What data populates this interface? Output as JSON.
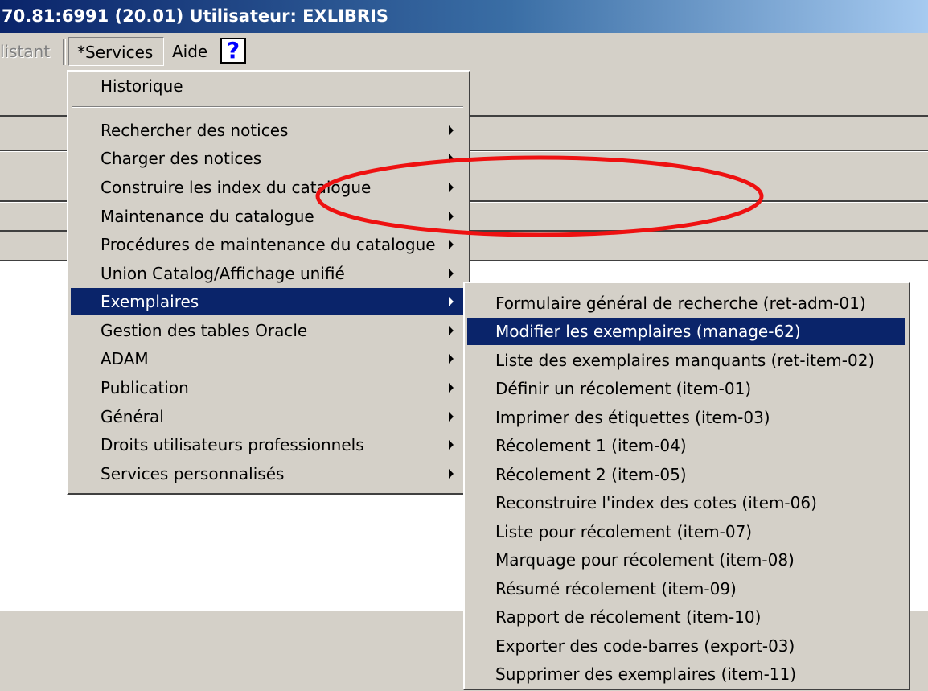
{
  "window": {
    "title": "70.81:6991 (20.01) Utilisateur: EXLIBRIS"
  },
  "menubar": {
    "assistant": "listant",
    "services": "*Services",
    "aide": "Aide",
    "help_glyph": "?"
  },
  "services_menu": {
    "items": [
      {
        "label": "Historique"
      },
      {
        "label": "Rechercher des notices"
      },
      {
        "label": "Charger des notices"
      },
      {
        "label": "Construire les index du catalogue"
      },
      {
        "label": "Maintenance du catalogue"
      },
      {
        "label": "Procédures de maintenance du catalogue"
      },
      {
        "label": "Union Catalog/Affichage unifié"
      },
      {
        "label": "Exemplaires"
      },
      {
        "label": "Gestion des tables Oracle"
      },
      {
        "label": "ADAM"
      },
      {
        "label": "Publication"
      },
      {
        "label": "Général"
      },
      {
        "label": "Droits utilisateurs professionnels"
      },
      {
        "label": "Services personnalisés"
      }
    ]
  },
  "exemplaires_submenu": {
    "items": [
      {
        "label": "Formulaire général de recherche (ret-adm-01)"
      },
      {
        "label": "Modifier les exemplaires (manage-62)"
      },
      {
        "label": "Liste des exemplaires manquants (ret-item-02)"
      },
      {
        "label": "Définir un récolement (item-01)"
      },
      {
        "label": "Imprimer des étiquettes (item-03)"
      },
      {
        "label": "Récolement 1 (item-04)"
      },
      {
        "label": "Récolement 2 (item-05)"
      },
      {
        "label": "Reconstruire l'index des cotes (item-06)"
      },
      {
        "label": "Liste pour récolement (item-07)"
      },
      {
        "label": "Marquage pour récolement (item-08)"
      },
      {
        "label": "Résumé récolement (item-09)"
      },
      {
        "label": "Rapport de récolement (item-10)"
      },
      {
        "label": "Exporter des code-barres (export-03)"
      },
      {
        "label": "Supprimer des exemplaires (item-11)"
      }
    ]
  },
  "colors": {
    "highlight": "#0a246a",
    "annotation": "#ee1111",
    "menu_face": "#d4d0c8"
  },
  "icons": {
    "submenu_arrow": "triangle-right-icon",
    "help": "question-mark-icon"
  }
}
